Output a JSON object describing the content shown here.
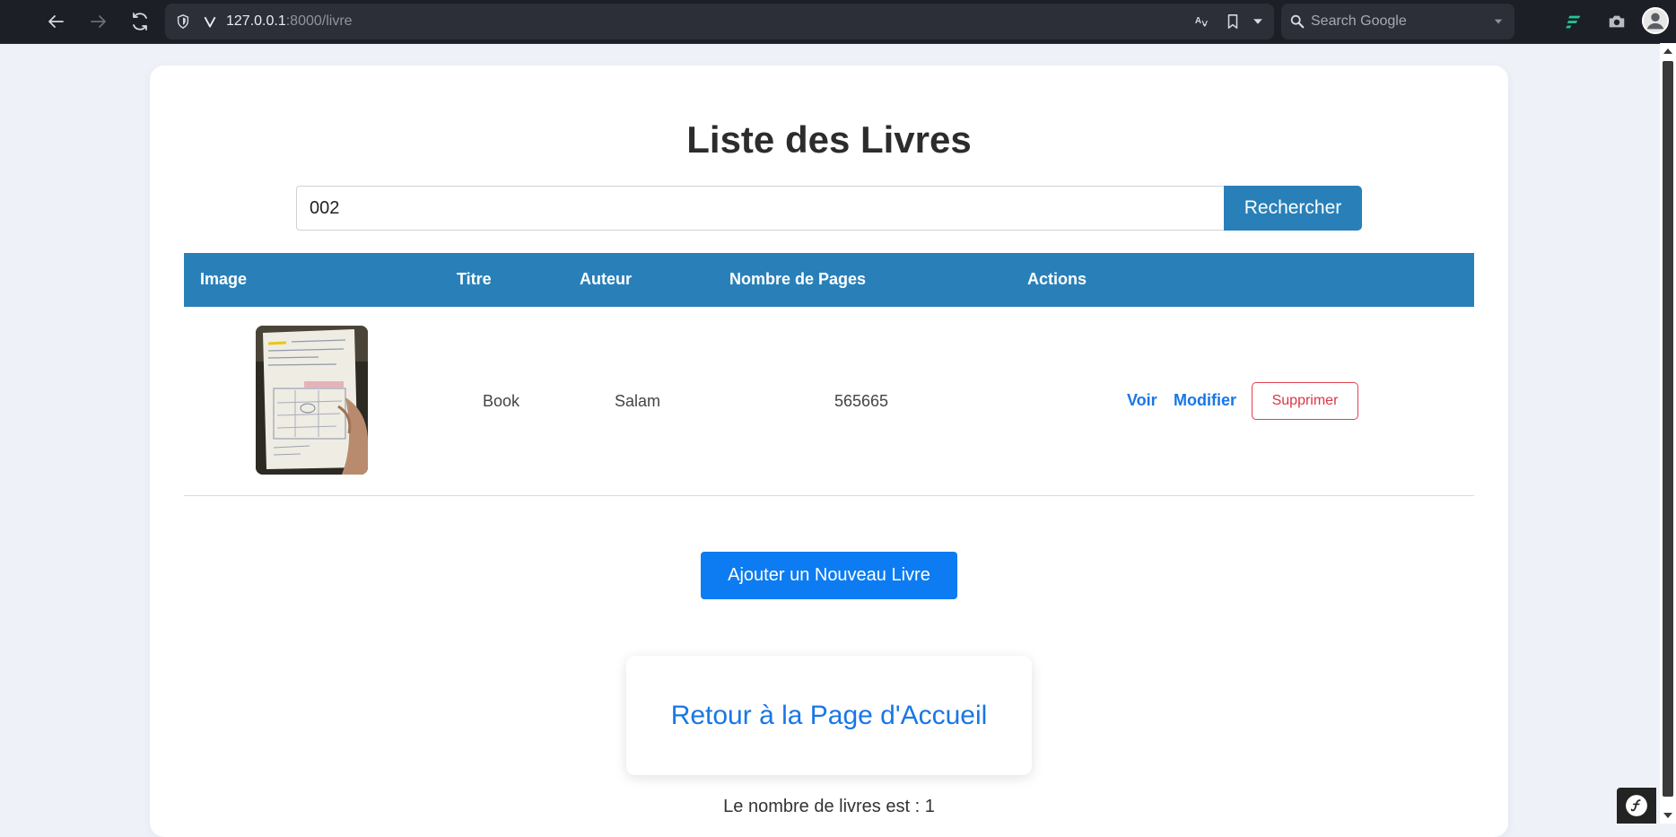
{
  "browser": {
    "url_host": "127.0.0.1",
    "url_path": ":8000/livre",
    "search_placeholder": "Search Google",
    "icons": [
      "back-icon",
      "forward-icon",
      "reload-icon",
      "shield-icon",
      "vivaldi-icon",
      "translate-icon",
      "bookmark-icon",
      "dropdown-icon",
      "search-icon",
      "extension-icon",
      "camera-icon",
      "avatar-icon"
    ]
  },
  "page": {
    "title": "Liste des Livres",
    "search": {
      "value": "002",
      "button_label": "Rechercher"
    },
    "table": {
      "headers": [
        "Image",
        "Titre",
        "Auteur",
        "Nombre de Pages",
        "Actions"
      ],
      "rows": [
        {
          "titre": "Book",
          "auteur": "Salam",
          "pages": "565665",
          "actions": [
            "Voir",
            "Modifier",
            "Supprimer"
          ]
        }
      ]
    },
    "add_button": "Ajouter un Nouveau Livre",
    "home_link": "Retour à la Page d'Accueil",
    "count_text": "Le nombre de livres est : 1"
  },
  "colors": {
    "primary": "#2980b9",
    "link": "#1877e6",
    "danger": "#dc3545",
    "background": "#eef2f8"
  }
}
